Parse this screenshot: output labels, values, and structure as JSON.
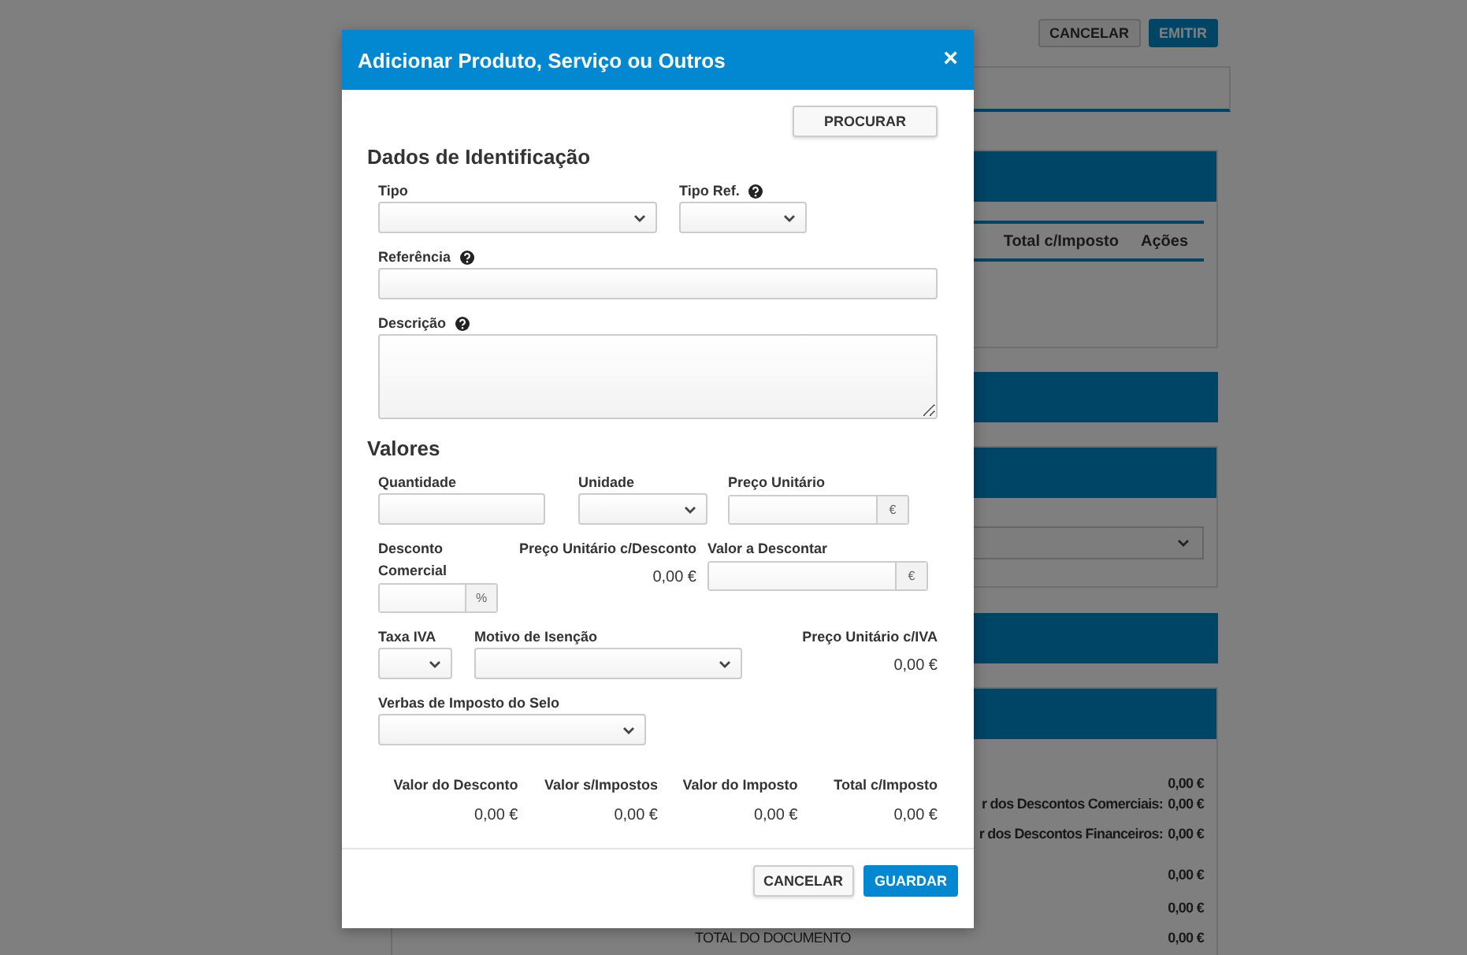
{
  "background_page": {
    "buttons": [
      {
        "label": "CANCELAR",
        "kind": "secondary"
      },
      {
        "label": "EMITIR",
        "kind": "primary"
      }
    ],
    "table_columns": [
      "Total c/Imposto",
      "Ações"
    ],
    "summary_rows": [
      {
        "kind": "plain",
        "value": "0,00 €"
      },
      {
        "kind": "plain",
        "label": "r dos Descontos Comerciais:",
        "value": "0,00 €"
      },
      {
        "kind": "plain",
        "label": "r dos Descontos Financeiros:",
        "value": "0,00 €"
      },
      {
        "kind": "plain",
        "value": "0,00 €"
      },
      {
        "kind": "plain",
        "value": "0,00 €"
      },
      {
        "kind": "total",
        "label": "TOTAL DO DOCUMENTO",
        "value": "0,00 €"
      }
    ]
  },
  "modal": {
    "title": "Adicionar Produto, Serviço ou Outros",
    "close": "×",
    "search_button": "PROCURAR",
    "sections": [
      {
        "heading": "Dados de Identificação",
        "rows": [
          [
            {
              "kind": "select",
              "label": "Tipo"
            },
            {
              "kind": "select",
              "label": "Tipo Ref.",
              "help": true
            }
          ],
          [
            {
              "kind": "input",
              "label": "Referência",
              "help": true
            }
          ],
          [
            {
              "kind": "textarea",
              "label": "Descrição",
              "help": true
            }
          ]
        ]
      },
      {
        "heading": "Valores",
        "rows": [
          [
            {
              "kind": "input",
              "label": "Quantidade"
            },
            {
              "kind": "select",
              "label": "Unidade"
            },
            {
              "kind": "addon",
              "label": "Preço Unitário",
              "addon": "€"
            }
          ],
          [
            {
              "kind": "addon",
              "label": "Desconto Comercial",
              "addon": "%"
            },
            {
              "kind": "readout",
              "label": "Preço Unitário c/Desconto",
              "value": "0,00 €"
            },
            {
              "kind": "addon",
              "label": "Valor a Descontar",
              "addon": "€"
            }
          ],
          [
            {
              "kind": "select",
              "label": "Taxa IVA"
            },
            {
              "kind": "select",
              "label": "Motivo de Isenção"
            },
            {
              "kind": "readout",
              "label": "Preço Unitário c/IVA",
              "value": "0,00 €"
            }
          ],
          [
            {
              "kind": "select",
              "label": "Verbas de Imposto do Selo"
            }
          ]
        ]
      }
    ],
    "totals": [
      {
        "label": "Valor do Desconto",
        "value": "0,00 €"
      },
      {
        "label": "Valor s/Impostos",
        "value": "0,00 €"
      },
      {
        "label": "Valor do Imposto",
        "value": "0,00 €"
      },
      {
        "label": "Total c/Imposto",
        "value": "0,00 €"
      }
    ],
    "buttons": [
      {
        "label": "CANCELAR",
        "kind": "secondary"
      },
      {
        "label": "GUARDAR",
        "kind": "primary"
      }
    ]
  }
}
